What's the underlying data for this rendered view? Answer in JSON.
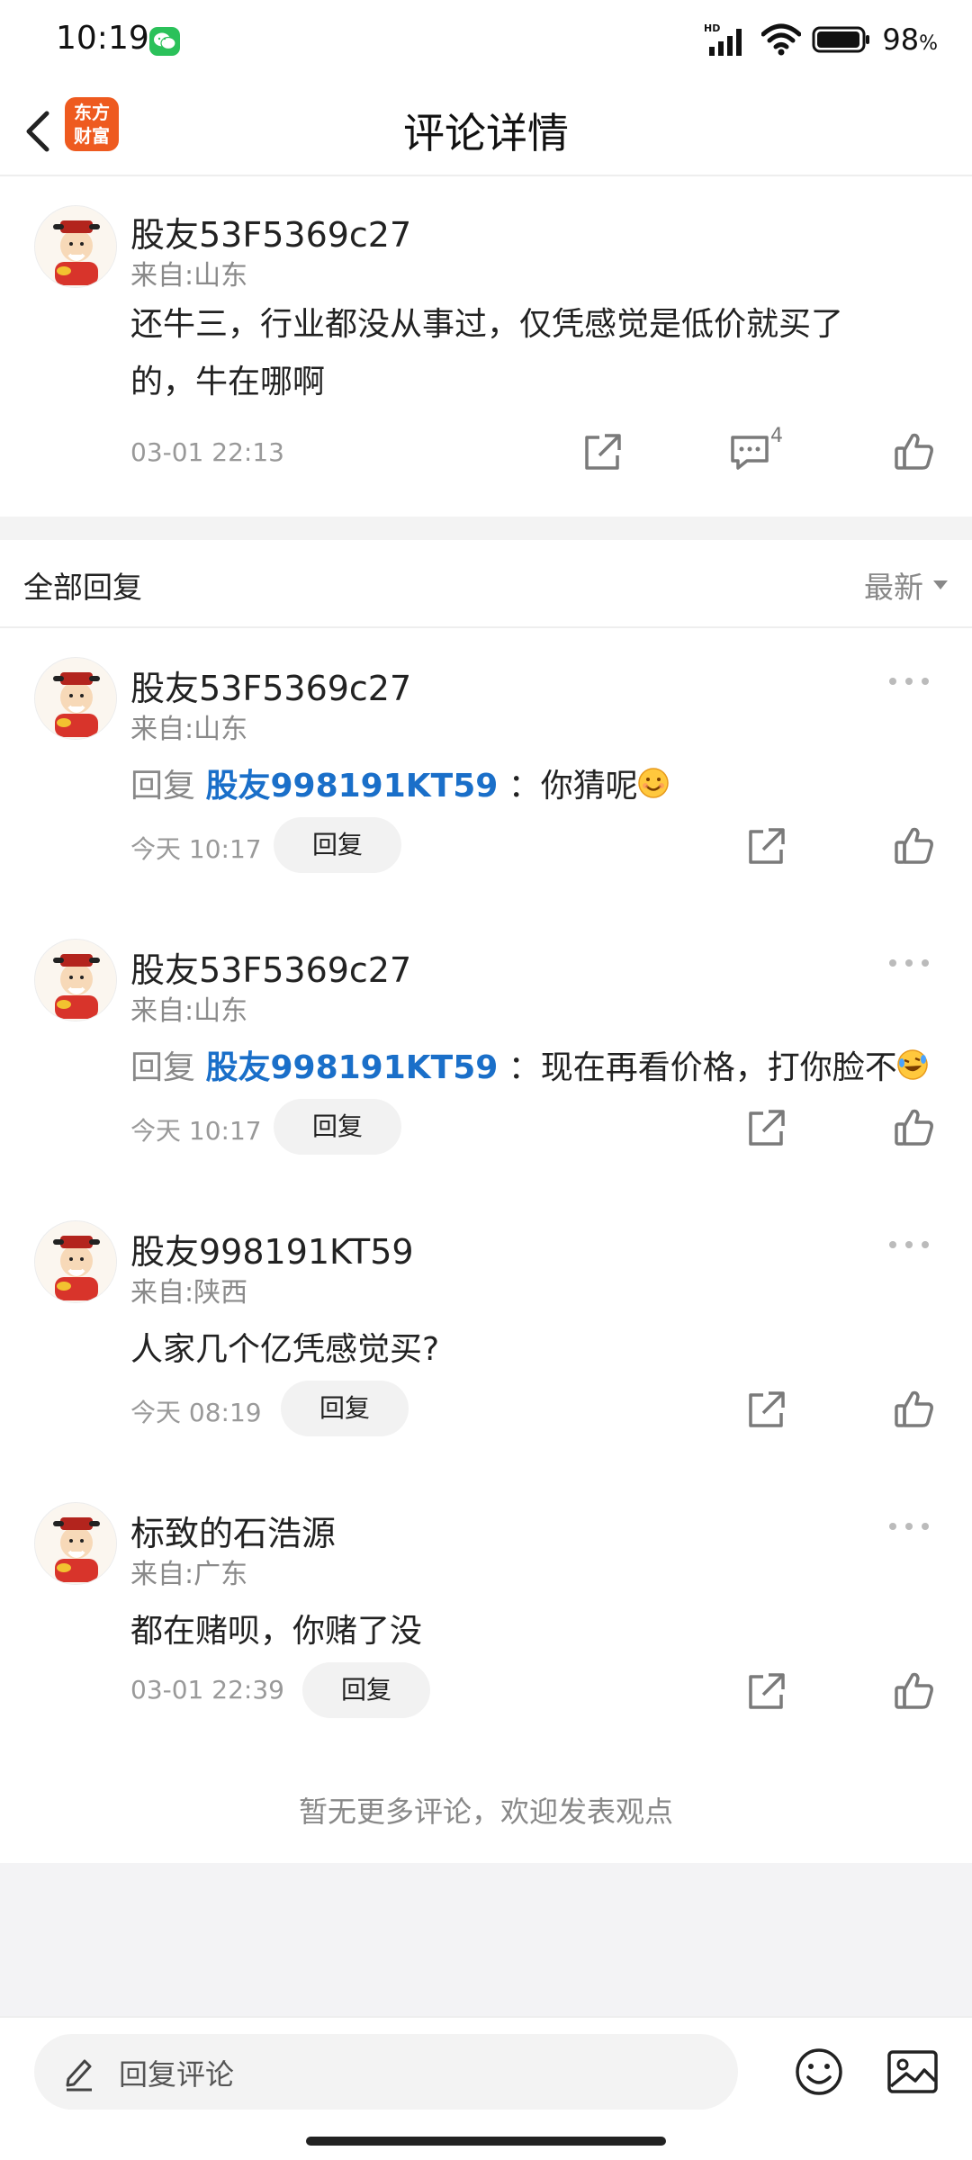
{
  "status_bar": {
    "time": "10:19",
    "hd_label": "HD",
    "battery_percent": "98",
    "battery_unit": "%"
  },
  "nav": {
    "title": "评论详情",
    "logo_line1": "东方",
    "logo_line2": "财富",
    "icons": [
      "back-arrow-icon",
      "app-logo-icon"
    ]
  },
  "main_comment": {
    "username": "股友53F5369c27",
    "location": "来自:山东",
    "text_line1": "还牛三，行业都没从事过，仅凭感觉是低价就买了",
    "text_line2": "的，牛在哪啊",
    "time": "03-01 22:13",
    "comment_count": "4",
    "icons": [
      "share-icon",
      "comment-icon",
      "like-icon"
    ]
  },
  "replies_header": {
    "title": "全部回复",
    "sort_label": "最新"
  },
  "replies": [
    {
      "username": "股友53F5369c27",
      "location": "来自:山东",
      "reply_prefix": "回复",
      "reply_target": "股友998191KT59",
      "text": "：你猜呢",
      "emoji": "smile-emoji",
      "time": "今天 10:17",
      "reply_button": "回复"
    },
    {
      "username": "股友53F5369c27",
      "location": "来自:山东",
      "reply_prefix": "回复",
      "reply_target": "股友998191KT59",
      "text": "：现在再看价格，打你脸不",
      "emoji": "laugh-cry-emoji",
      "time": "今天 10:17",
      "reply_button": "回复"
    },
    {
      "username": "股友998191KT59",
      "location": "来自:陕西",
      "text": "人家几个亿凭感觉买?",
      "time": "今天 08:19",
      "reply_button": "回复"
    },
    {
      "username": "标致的石浩源",
      "location": "来自:广东",
      "text": "都在赌呗，你赌了没",
      "time": "03-01 22:39",
      "reply_button": "回复"
    }
  ],
  "footer_note": "暂无更多评论，欢迎发表观点",
  "bottom_bar": {
    "input_placeholder": "回复评论",
    "icons": [
      "pencil-icon",
      "emoji-icon",
      "image-icon"
    ]
  },
  "colors": {
    "link_blue": "#1a6fc9",
    "logo_orange": "#ee5a1f",
    "wechat_green": "#2bc15a"
  }
}
